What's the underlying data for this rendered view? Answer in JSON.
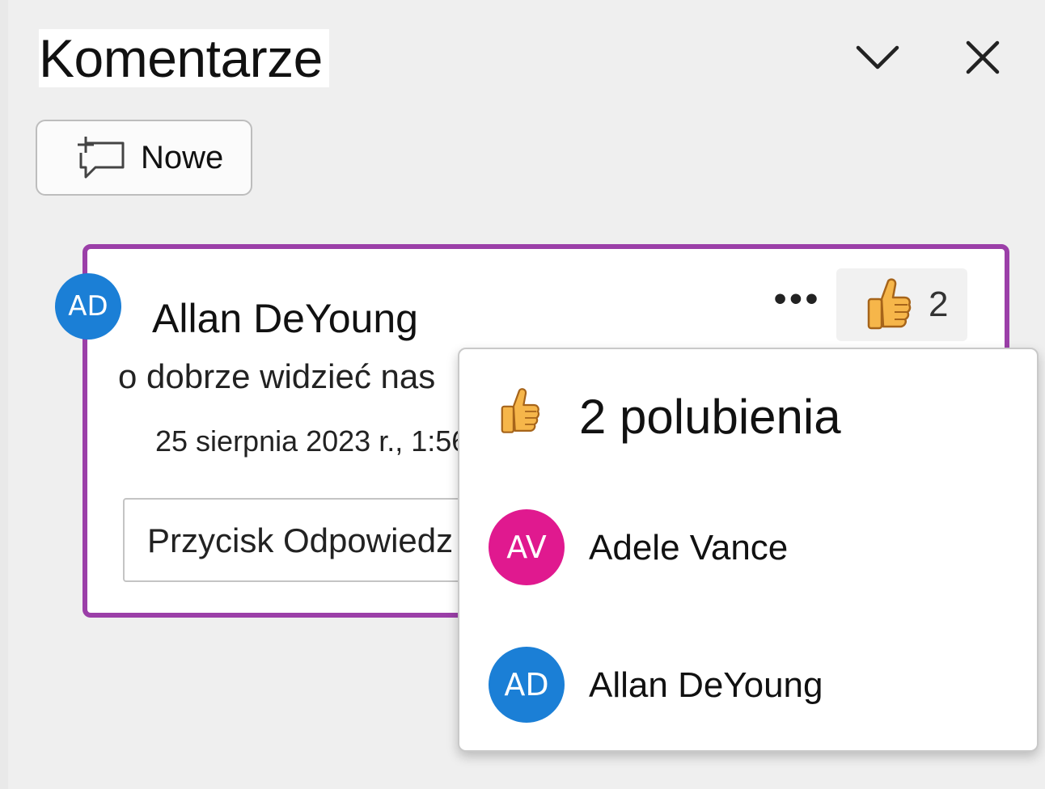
{
  "panel": {
    "title": "Komentarze",
    "collapse_icon": "chevron-down-icon",
    "close_icon": "close-icon"
  },
  "toolbar": {
    "new_label": "Nowe",
    "new_icon": "new-comment-icon"
  },
  "comment": {
    "author_initials": "AD",
    "author": "Allan DeYoung",
    "text": "o dobrze widzieć nas",
    "timestamp": "25 sierpnia 2023 r., 1:56",
    "more_label": "•••",
    "like_count": "2",
    "reply_placeholder": "Przycisk Odpowiedz",
    "colors": {
      "border": "#9b3fa8",
      "avatar": "#1b7fd6"
    }
  },
  "likes_popup": {
    "title": "2 polubienia",
    "likers": [
      {
        "initials": "AV",
        "name": "Adele Vance",
        "color": "#e0198f"
      },
      {
        "initials": "AD",
        "name": "Allan DeYoung",
        "color": "#1b7fd6"
      }
    ]
  }
}
